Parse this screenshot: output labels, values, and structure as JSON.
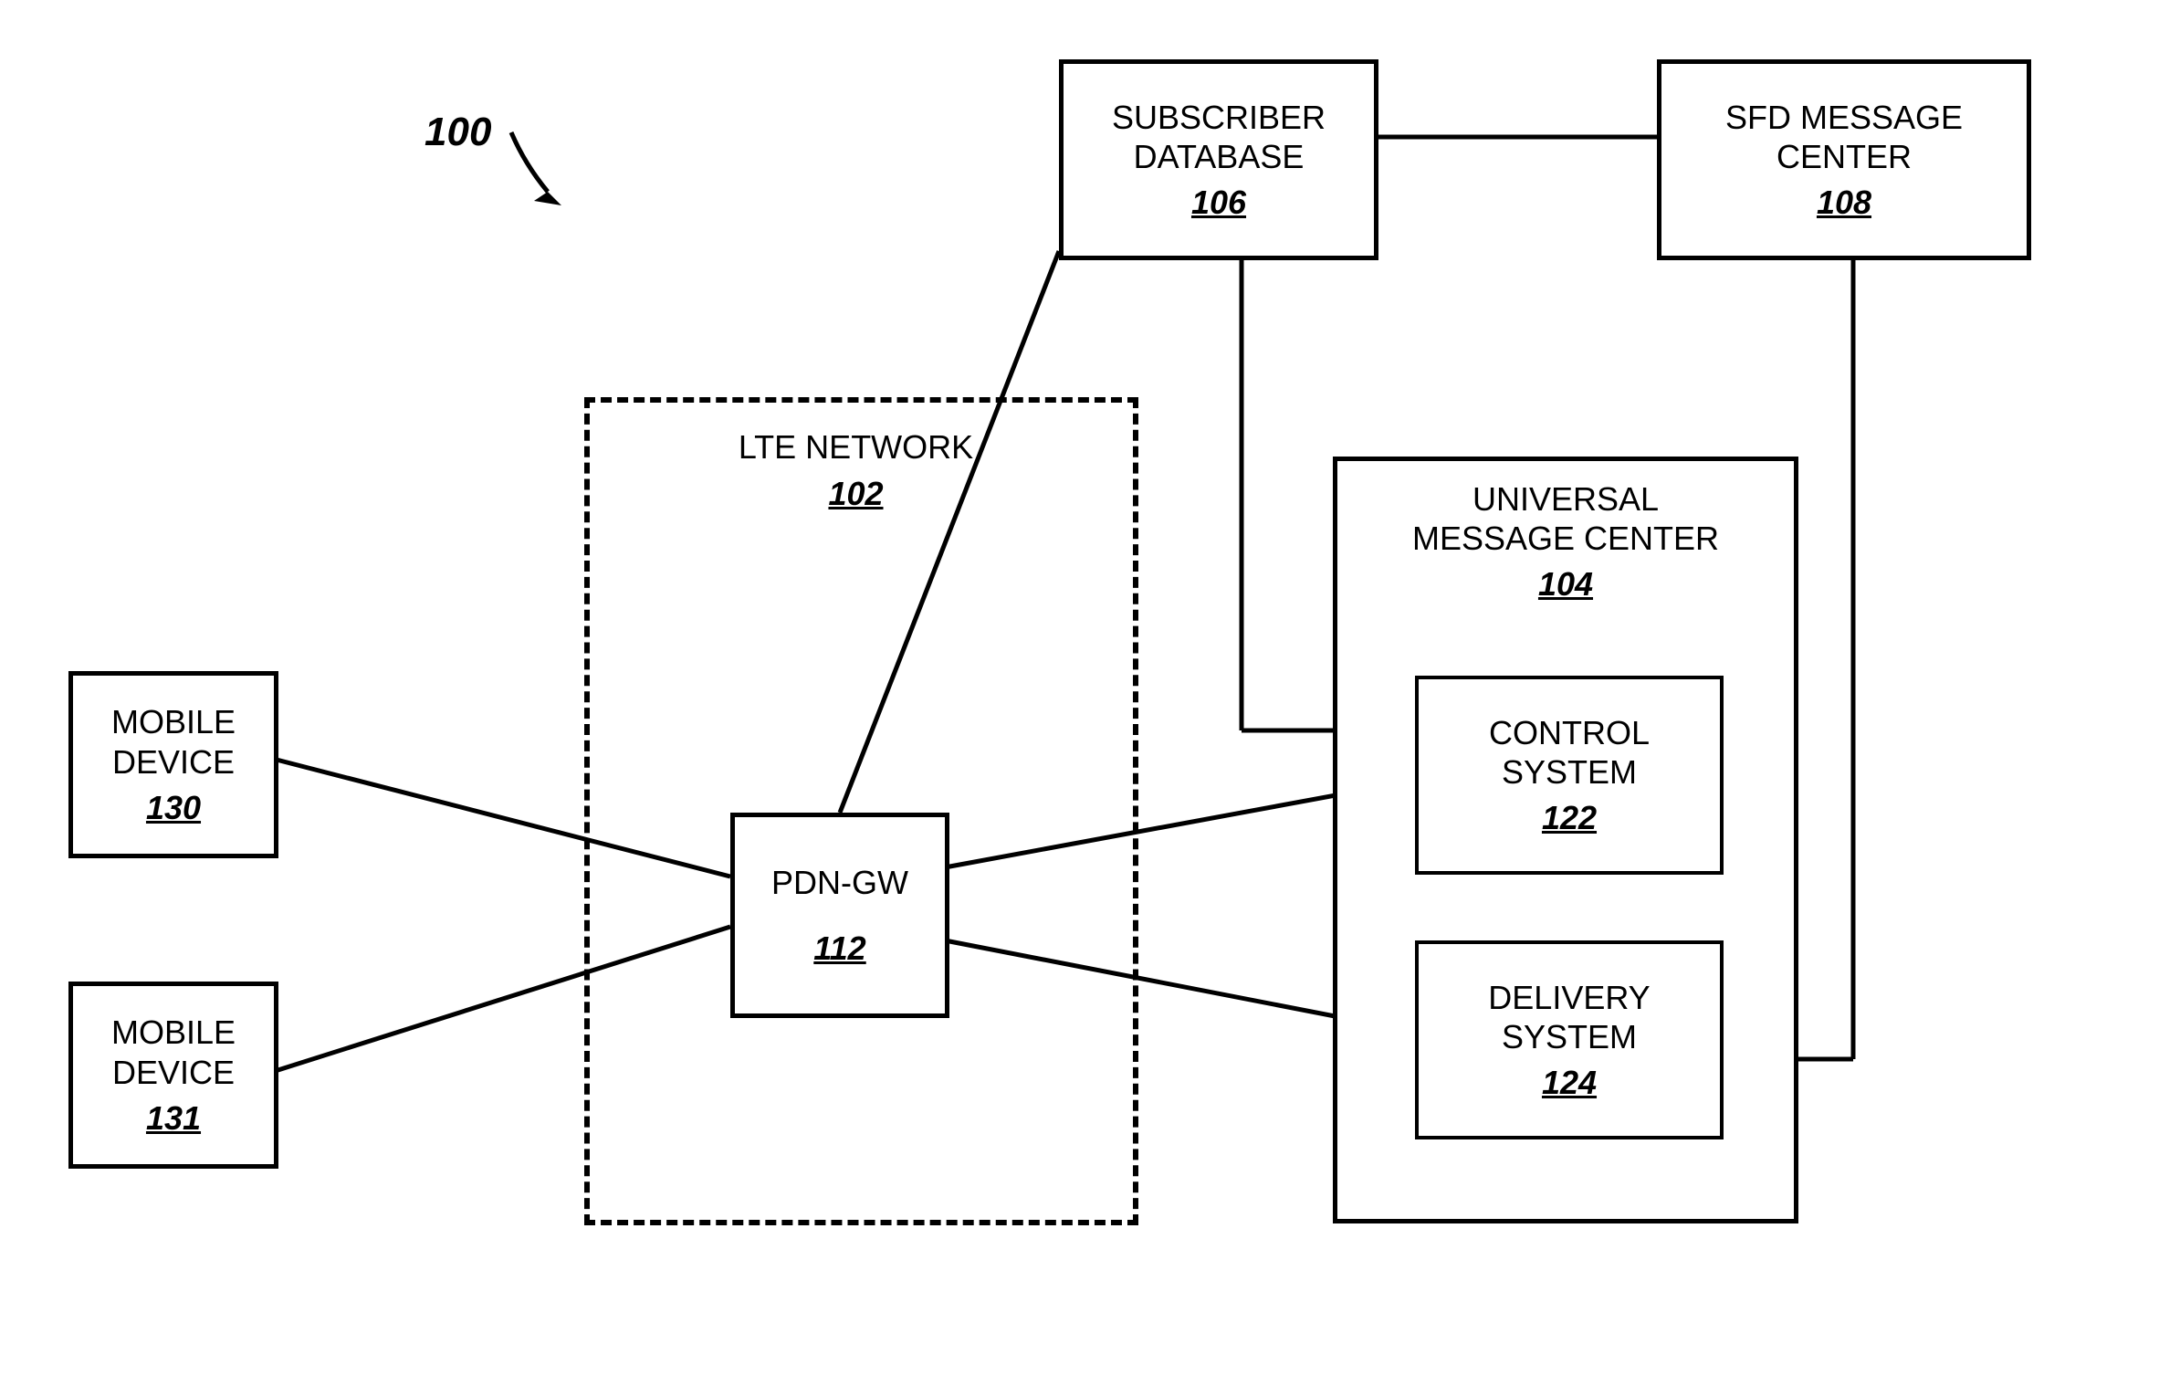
{
  "figure_label": "100",
  "lte_network": {
    "title": "LTE NETWORK",
    "ref": "102"
  },
  "pdn_gw": {
    "title": "PDN-GW",
    "ref": "112"
  },
  "mobile_device_1": {
    "title_l1": "MOBILE",
    "title_l2": "DEVICE",
    "ref": "130"
  },
  "mobile_device_2": {
    "title_l1": "MOBILE",
    "title_l2": "DEVICE",
    "ref": "131"
  },
  "subscriber_db": {
    "title_l1": "SUBSCRIBER",
    "title_l2": "DATABASE",
    "ref": "106"
  },
  "sfd_center": {
    "title_l1": "SFD MESSAGE",
    "title_l2": "CENTER",
    "ref": "108"
  },
  "universal_mc": {
    "title_l1": "UNIVERSAL",
    "title_l2": "MESSAGE CENTER",
    "ref": "104"
  },
  "control_system": {
    "title_l1": "CONTROL",
    "title_l2": "SYSTEM",
    "ref": "122"
  },
  "delivery_system": {
    "title_l1": "DELIVERY",
    "title_l2": "SYSTEM",
    "ref": "124"
  }
}
